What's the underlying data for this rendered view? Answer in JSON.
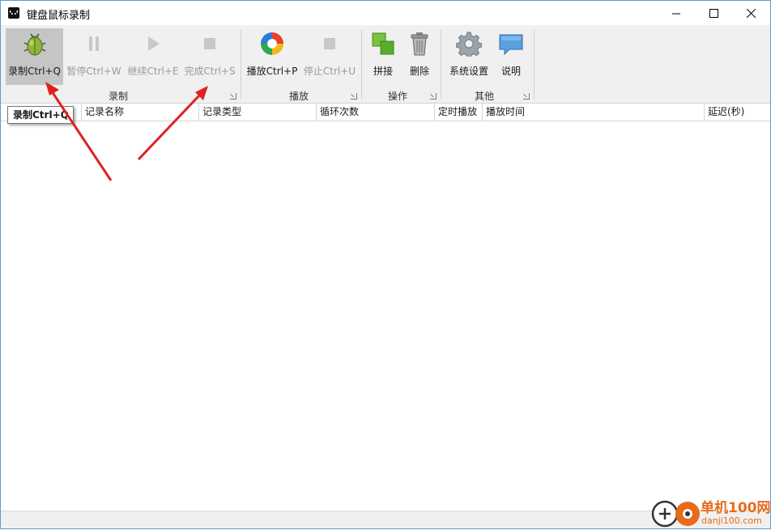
{
  "window": {
    "title": "键盘鼠标录制"
  },
  "ribbon": {
    "groups": [
      {
        "label": "录制"
      },
      {
        "label": "播放"
      },
      {
        "label": "操作"
      },
      {
        "label": "其他"
      }
    ],
    "buttons": {
      "record": "录制Ctrl+Q",
      "pause": "暂停Ctrl+W",
      "resume": "继续Ctrl+E",
      "finish": "完成Ctrl+S",
      "play": "播放Ctrl+P",
      "stop": "停止Ctrl+U",
      "merge": "拼接",
      "delete": "删除",
      "settings": "系统设置",
      "help": "说明"
    }
  },
  "table": {
    "columns": [
      "记录名称",
      "记录类型",
      "循环次数",
      "定时播放",
      "播放时间",
      "延迟(秒)"
    ],
    "rows": []
  },
  "tooltip": {
    "text": "录制Ctrl+Q"
  },
  "watermark": {
    "name": "单机100网",
    "url": "danji100.com"
  },
  "colors": {
    "accent": "#5b9bd5",
    "arrow": "#e02020",
    "watermark": "#e86a1c"
  }
}
